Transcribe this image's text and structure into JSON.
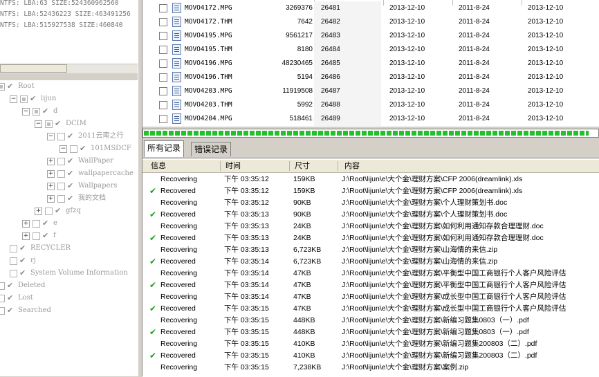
{
  "left_log": {
    "lines": [
      "NTFS: LBA:63 SIZE:524360962560",
      "NTFS: LBA:52436223 SIZE:463491256",
      "NTFS: LBA:515927538 SIZE:460840"
    ]
  },
  "tree": {
    "nodes": [
      {
        "label": "Root",
        "depth": 0,
        "expander": "",
        "check": "partial"
      },
      {
        "label": "lijun",
        "depth": 1,
        "expander": "−",
        "check": "partial"
      },
      {
        "label": "d",
        "depth": 2,
        "expander": "−",
        "check": "partial"
      },
      {
        "label": "DCIM",
        "depth": 3,
        "expander": "−",
        "check": "partial"
      },
      {
        "label": "2011云南之行",
        "depth": 4,
        "expander": "−",
        "check": "empty"
      },
      {
        "label": "101MSDCF",
        "depth": 5,
        "expander": "−",
        "check": "empty"
      },
      {
        "label": "WallPaper",
        "depth": 4,
        "expander": "+",
        "check": "empty"
      },
      {
        "label": "wallpapercache",
        "depth": 4,
        "expander": "+",
        "check": "empty"
      },
      {
        "label": "Wallpapers",
        "depth": 4,
        "expander": "+",
        "check": "empty"
      },
      {
        "label": "我的文档",
        "depth": 4,
        "expander": "+",
        "check": "empty"
      },
      {
        "label": "gfzq",
        "depth": 3,
        "expander": "+",
        "check": "empty"
      },
      {
        "label": "e",
        "depth": 2,
        "expander": "+",
        "check": "checked"
      },
      {
        "label": "f",
        "depth": 2,
        "expander": "+",
        "check": "checked"
      },
      {
        "label": "RECYCLER",
        "depth": 1,
        "expander": "",
        "check": "empty"
      },
      {
        "label": "rj",
        "depth": 1,
        "expander": "",
        "check": "empty"
      },
      {
        "label": "System Volume Information",
        "depth": 1,
        "expander": "",
        "check": "empty"
      },
      {
        "label": "Deleted",
        "depth": 0,
        "expander": "",
        "check": "empty"
      },
      {
        "label": "Lost",
        "depth": 0,
        "expander": "",
        "check": "empty"
      },
      {
        "label": "Searched",
        "depth": 0,
        "expander": "",
        "check": "empty"
      }
    ]
  },
  "files": {
    "rows": [
      {
        "name": "MOVO4172.MPG",
        "size": "3269376",
        "lba": "26481",
        "date1": "2013-12-10",
        "date2": "2011-8-24",
        "date3": "2013-12-10"
      },
      {
        "name": "MOVO4172.THM",
        "size": "7642",
        "lba": "26482",
        "date1": "2013-12-10",
        "date2": "2011-8-24",
        "date3": "2013-12-10"
      },
      {
        "name": "MOVO4195.MPG",
        "size": "9561217",
        "lba": "26483",
        "date1": "2013-12-10",
        "date2": "2011-8-24",
        "date3": "2013-12-10"
      },
      {
        "name": "MOVO4195.THM",
        "size": "8180",
        "lba": "26484",
        "date1": "2013-12-10",
        "date2": "2011-8-24",
        "date3": "2013-12-10"
      },
      {
        "name": "MOVO4196.MPG",
        "size": "48230465",
        "lba": "26485",
        "date1": "2013-12-10",
        "date2": "2011-8-24",
        "date3": "2013-12-10"
      },
      {
        "name": "MOVO4196.THM",
        "size": "5194",
        "lba": "26486",
        "date1": "2013-12-10",
        "date2": "2011-8-24",
        "date3": "2013-12-10"
      },
      {
        "name": "MOVO4203.MPG",
        "size": "11919508",
        "lba": "26487",
        "date1": "2013-12-10",
        "date2": "2011-8-24",
        "date3": "2013-12-10"
      },
      {
        "name": "MOVO4203.THM",
        "size": "5992",
        "lba": "26488",
        "date1": "2013-12-10",
        "date2": "2011-8-24",
        "date3": "2013-12-10"
      },
      {
        "name": "MOVO4204.MPG",
        "size": "518461",
        "lba": "26489",
        "date1": "2013-12-10",
        "date2": "2011-8-24",
        "date3": "2013-12-10"
      }
    ]
  },
  "progress": {
    "fraction": 0.98,
    "color": "#22c02a"
  },
  "tabs": [
    {
      "label": "所有记录",
      "active": true
    },
    {
      "label": "错误记录",
      "active": false
    }
  ],
  "log": {
    "headers": {
      "info": "信息",
      "time": "时间",
      "size": "尺寸",
      "content": "内容"
    },
    "rows": [
      {
        "status": "Recovering",
        "ok": false,
        "time": "下午 03:35:12",
        "size": "159KB",
        "path": "J:\\Root\\lijun\\e\\大个金\\理财方案\\CFP 2006(dreamlink).xls"
      },
      {
        "status": "Recovered",
        "ok": true,
        "time": "下午 03:35:12",
        "size": "159KB",
        "path": "J:\\Root\\lijun\\e\\大个金\\理财方案\\CFP 2006(dreamlink).xls"
      },
      {
        "status": "Recovering",
        "ok": false,
        "time": "下午 03:35:12",
        "size": "90KB",
        "path": "J:\\Root\\lijun\\e\\大个金\\理财方案\\个人理财策划书.doc"
      },
      {
        "status": "Recovered",
        "ok": true,
        "time": "下午 03:35:13",
        "size": "90KB",
        "path": "J:\\Root\\lijun\\e\\大个金\\理财方案\\个人理财策划书.doc"
      },
      {
        "status": "Recovering",
        "ok": false,
        "time": "下午 03:35:13",
        "size": "24KB",
        "path": "J:\\Root\\lijun\\e\\大个金\\理财方案\\如何利用通知存款合理理财.doc"
      },
      {
        "status": "Recovered",
        "ok": true,
        "time": "下午 03:35:13",
        "size": "24KB",
        "path": "J:\\Root\\lijun\\e\\大个金\\理财方案\\如何利用通知存款合理理财.doc"
      },
      {
        "status": "Recovering",
        "ok": false,
        "time": "下午 03:35:13",
        "size": "6,723KB",
        "path": "J:\\Root\\lijun\\e\\大个金\\理财方案\\山海情的来信.zip"
      },
      {
        "status": "Recovered",
        "ok": true,
        "time": "下午 03:35:14",
        "size": "6,723KB",
        "path": "J:\\Root\\lijun\\e\\大个金\\理财方案\\山海情的来信.zip"
      },
      {
        "status": "Recovering",
        "ok": false,
        "time": "下午 03:35:14",
        "size": "47KB",
        "path": "J:\\Root\\lijun\\e\\大个金\\理财方案\\平衡型中国工商银行个人客户风险评估"
      },
      {
        "status": "Recovered",
        "ok": true,
        "time": "下午 03:35:14",
        "size": "47KB",
        "path": "J:\\Root\\lijun\\e\\大个金\\理财方案\\平衡型中国工商银行个人客户风险评估"
      },
      {
        "status": "Recovering",
        "ok": false,
        "time": "下午 03:35:14",
        "size": "47KB",
        "path": "J:\\Root\\lijun\\e\\大个金\\理财方案\\成长型中国工商银行个人客户风险评估"
      },
      {
        "status": "Recovered",
        "ok": true,
        "time": "下午 03:35:15",
        "size": "47KB",
        "path": "J:\\Root\\lijun\\e\\大个金\\理财方案\\成长型中国工商银行个人客户风险评估"
      },
      {
        "status": "Recovering",
        "ok": false,
        "time": "下午 03:35:15",
        "size": "448KB",
        "path": "J:\\Root\\lijun\\e\\大个金\\理财方案\\新编习题集0803（一）.pdf"
      },
      {
        "status": "Recovered",
        "ok": true,
        "time": "下午 03:35:15",
        "size": "448KB",
        "path": "J:\\Root\\lijun\\e\\大个金\\理财方案\\新编习题集0803（一）.pdf"
      },
      {
        "status": "Recovering",
        "ok": false,
        "time": "下午 03:35:15",
        "size": "410KB",
        "path": "J:\\Root\\lijun\\e\\大个金\\理财方案\\新编习题集200803（二）.pdf"
      },
      {
        "status": "Recovered",
        "ok": true,
        "time": "下午 03:35:15",
        "size": "410KB",
        "path": "J:\\Root\\lijun\\e\\大个金\\理财方案\\新编习题集200803（二）.pdf"
      },
      {
        "status": "Recovering",
        "ok": false,
        "time": "下午 03:35:15",
        "size": "7,238KB",
        "path": "J:\\Root\\lijun\\e\\大个金\\理财方案\\案例.zip"
      }
    ]
  }
}
